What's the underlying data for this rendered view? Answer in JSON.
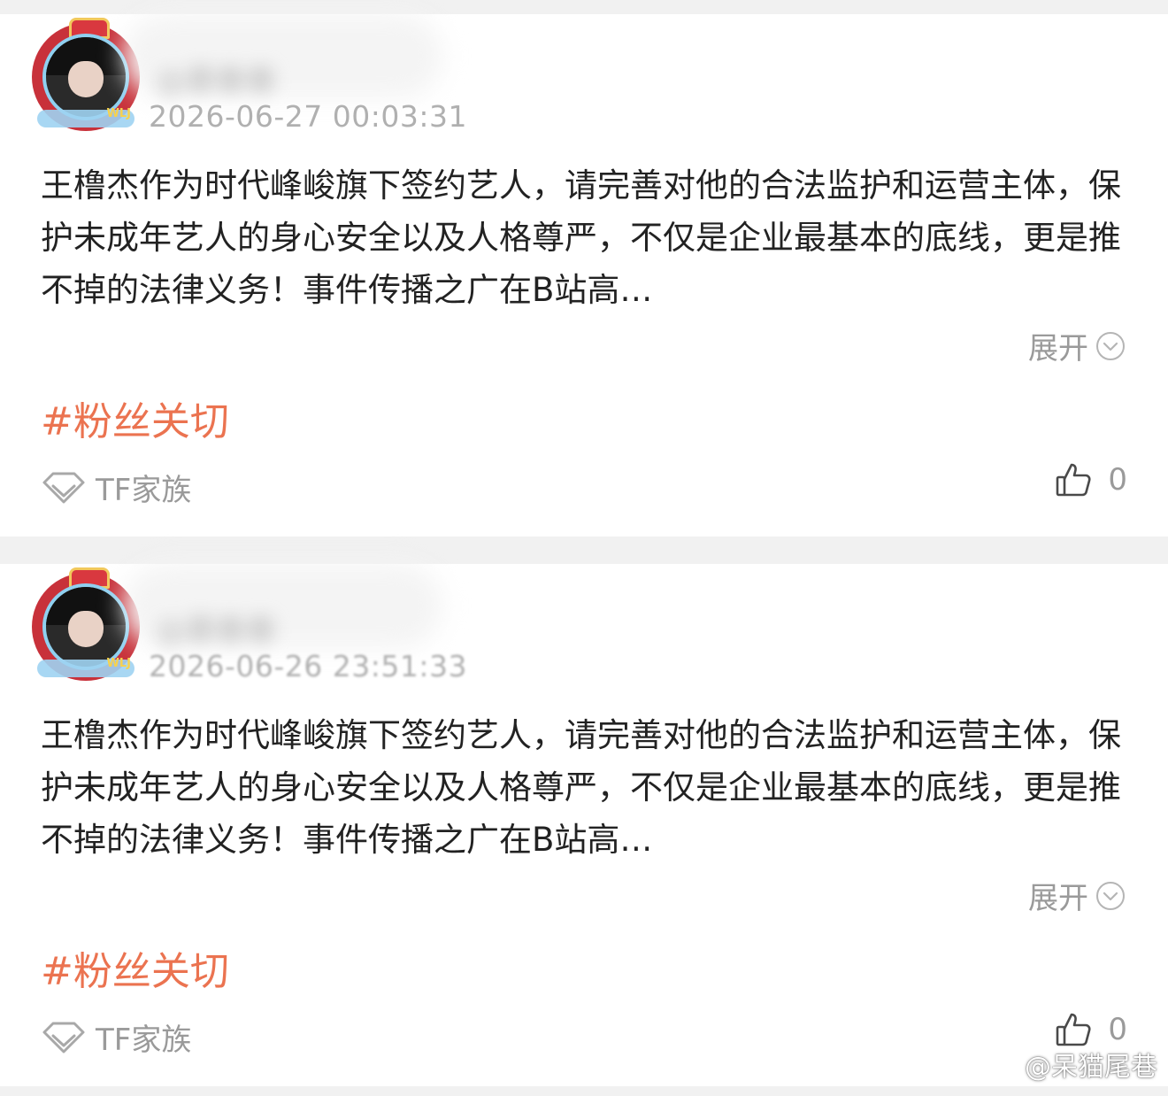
{
  "posts": [
    {
      "username": "@慕春春",
      "timestamp": "2026-06-27 00:03:31",
      "content": "王橹杰作为时代峰峻旗下签约艺人，请完善对他的合法监护和运营主体，保护未成年艺人的身心安全以及人格尊严，不仅是企业最基本的底线，更是推不掉的法律义务！事件传播之广在B站高…",
      "expand_label": "展开",
      "hashtag": "#粉丝关切",
      "source": "TF家族",
      "like_count": "0",
      "avatar_badge": "WLJ"
    },
    {
      "username": "@慕春春",
      "timestamp": "2026-06-26 23:51:33",
      "content": "王橹杰作为时代峰峻旗下签约艺人，请完善对他的合法监护和运营主体，保护未成年艺人的身心安全以及人格尊严，不仅是企业最基本的底线，更是推不掉的法律义务！事件传播之广在B站高…",
      "expand_label": "展开",
      "hashtag": "#粉丝关切",
      "source": "TF家族",
      "like_count": "0",
      "avatar_badge": "WLJ"
    }
  ],
  "watermark": {
    "text": "@呆猫尾巷",
    "icon": "weibo-logo-icon"
  },
  "colors": {
    "hashtag": "#eb7350",
    "meta": "#9a9a9a",
    "text": "#222222",
    "background": "#f1f1f1"
  }
}
